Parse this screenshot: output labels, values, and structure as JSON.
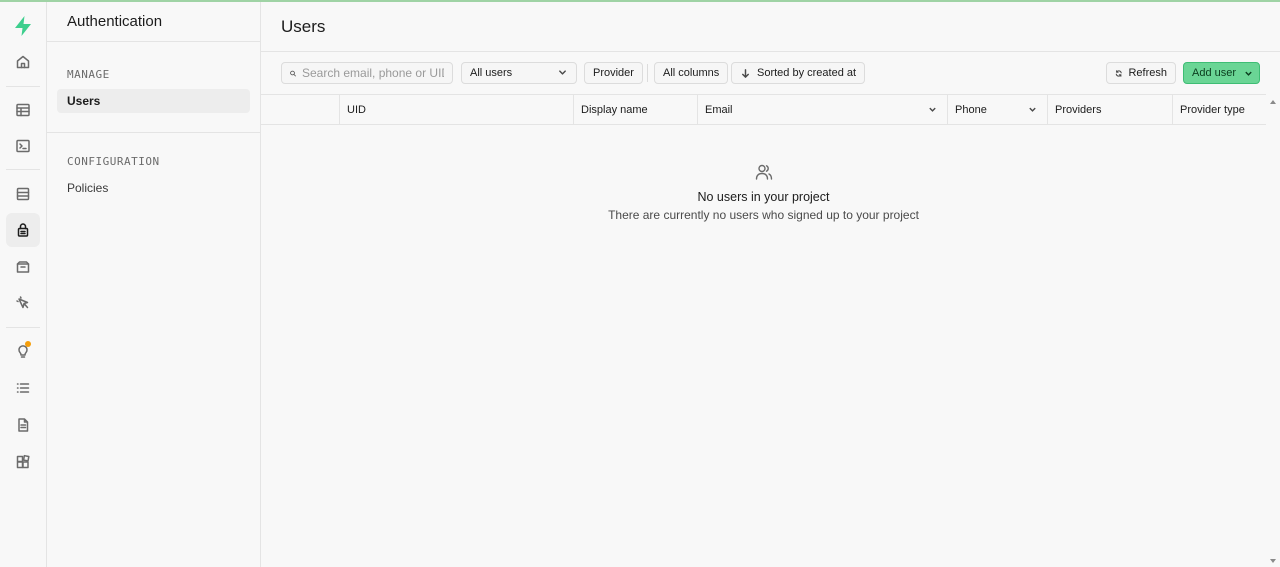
{
  "rail": {
    "icons": [
      "logo-icon",
      "home-icon",
      "table-editor-icon",
      "sql-editor-icon",
      "database-icon",
      "auth-lock-icon",
      "storage-icon",
      "edge-functions-icon",
      "advisors-icon",
      "logs-icon",
      "docs-icon",
      "integrations-icon"
    ],
    "accent_color": "#3ecf8e",
    "notification_color": "#f59e0b"
  },
  "sidebar": {
    "title": "Authentication",
    "sections": [
      {
        "label": "MANAGE",
        "items": [
          {
            "label": "Users",
            "active": true
          }
        ]
      },
      {
        "label": "CONFIGURATION",
        "items": [
          {
            "label": "Policies",
            "active": false
          }
        ]
      }
    ]
  },
  "main": {
    "title": "Users",
    "toolbar": {
      "search_placeholder": "Search email, phone or UID",
      "filter_users": "All users",
      "provider": "Provider",
      "columns": "All columns",
      "sort": "Sorted by created at",
      "refresh": "Refresh",
      "add_user": "Add user"
    },
    "table": {
      "columns": [
        "UID",
        "Display name",
        "Email",
        "Phone",
        "Providers",
        "Provider type"
      ]
    },
    "empty_state": {
      "title": "No users in your project",
      "subtitle": "There are currently no users who signed up to your project"
    },
    "primary_color": "#6ad595"
  }
}
